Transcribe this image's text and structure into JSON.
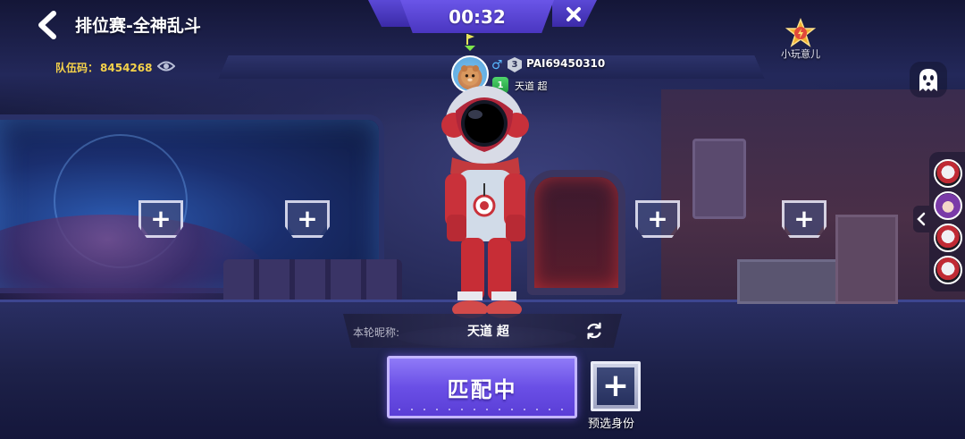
{
  "header": {
    "title": "排位赛-全神乱斗",
    "team_code_label": "队伍码：",
    "team_code_value": "8454268"
  },
  "timer": {
    "value": "00:32"
  },
  "rank_badge": {
    "label": "小玩意儿"
  },
  "player": {
    "level": "3",
    "id": "PAI69450310",
    "title_badge": "1",
    "nickname": "天道 超"
  },
  "nickname_bar": {
    "label": "本轮昵称:",
    "value": "天道 超"
  },
  "buttons": {
    "match_label": "匹配中",
    "preselect_label": "预选身份"
  },
  "add_slots": [
    {
      "icon": "plus-icon"
    },
    {
      "icon": "plus-icon"
    },
    {
      "icon": "plus-icon"
    },
    {
      "icon": "plus-icon"
    }
  ],
  "side_players": [
    {
      "icon": "player-avatar"
    },
    {
      "icon": "player-avatar"
    },
    {
      "icon": "player-avatar"
    },
    {
      "icon": "player-avatar"
    }
  ],
  "colors": {
    "accent": "#6a4fe6",
    "team_code": "#f5d24a",
    "gender": "#59b8ff"
  }
}
